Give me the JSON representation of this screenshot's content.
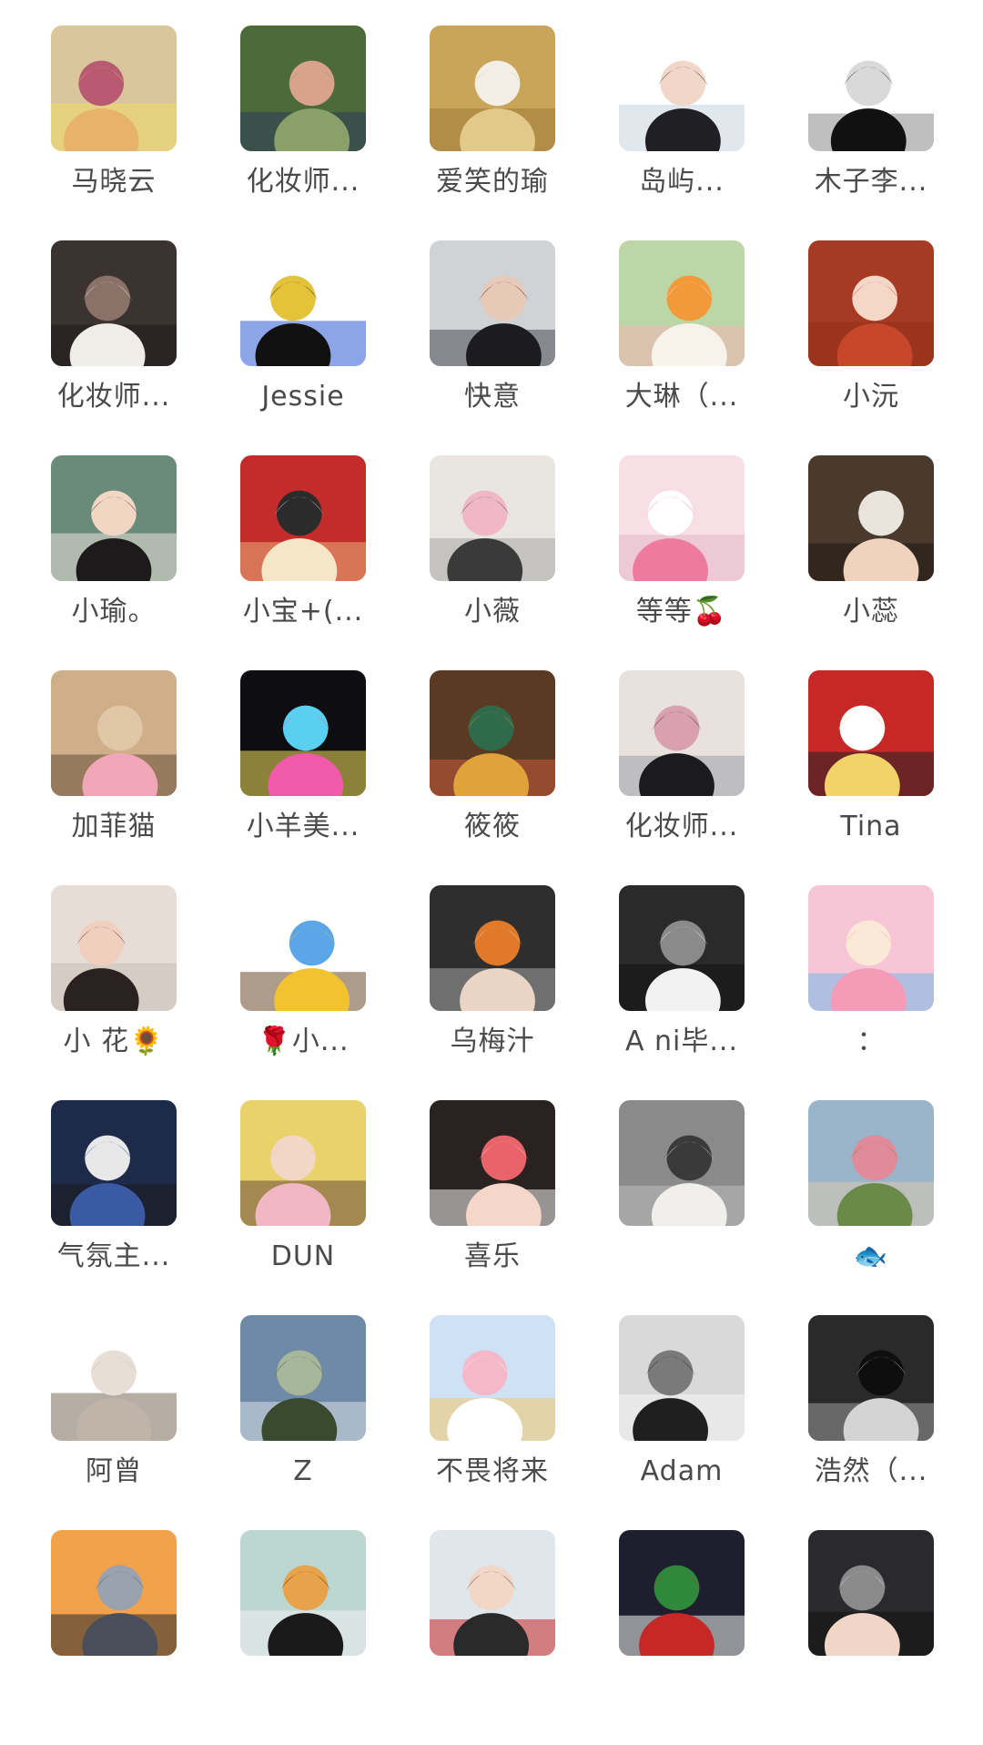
{
  "members": [
    {
      "name": "马晓云",
      "icon": "balloon-field-avatar",
      "colors": [
        "#d9c79b",
        "#e7b36b",
        "#b85a72",
        "#f1d86a"
      ]
    },
    {
      "name": "化妆师...",
      "icon": "woman-outdoor-photo-avatar",
      "colors": [
        "#4d6a3a",
        "#8aa06a",
        "#d8a38a",
        "#2e3a5a"
      ]
    },
    {
      "name": "爱笑的瑜",
      "icon": "woman-wheatfield-avatar",
      "colors": [
        "#c9a55a",
        "#e2c98a",
        "#f3efe6",
        "#9c7a3a"
      ]
    },
    {
      "name": "岛屿...",
      "icon": "anime-girl-glasses-avatar",
      "colors": [
        "#ffffff",
        "#1f1f24",
        "#f1d7c7",
        "#c6d4df"
      ]
    },
    {
      "name": "木子李...",
      "icon": "ink-sketch-girl-avatar",
      "colors": [
        "#ffffff",
        "#111111",
        "#d9d9d9",
        "#8a8a8a"
      ]
    },
    {
      "name": "化妆师...",
      "icon": "woman-turtleneck-avatar",
      "colors": [
        "#3a3330",
        "#f0ede8",
        "#8a7268",
        "#1d1a19"
      ]
    },
    {
      "name": "Jessie",
      "icon": "child-drawing-avatar",
      "colors": [
        "#ffffff",
        "#111111",
        "#e4c33a",
        "#2e5bd7"
      ]
    },
    {
      "name": "快意",
      "icon": "woman-portrait-avatar",
      "colors": [
        "#cfd3d6",
        "#1c1c20",
        "#e8c9b8",
        "#4a4e58"
      ]
    },
    {
      "name": "大琳（...",
      "icon": "bunny-carrot-avatar",
      "colors": [
        "#bcd6a6",
        "#f7f3ea",
        "#f29a3a",
        "#f2b6b6"
      ]
    },
    {
      "name": "小沅",
      "icon": "red-square-avatar",
      "colors": [
        "#a63a22",
        "#c7472b",
        "#f5d7c8",
        "#8f2f1a"
      ]
    },
    {
      "name": "小瑜。",
      "icon": "anime-curly-hair-avatar",
      "colors": [
        "#6a8a7a",
        "#1d1a1c",
        "#f2d6c4",
        "#e9e2d8"
      ]
    },
    {
      "name": "小宝+(...",
      "icon": "sticker-grid-avatar",
      "colors": [
        "#c42b2b",
        "#f5e6c8",
        "#2b2b2b",
        "#e8b37a"
      ]
    },
    {
      "name": "小薇",
      "icon": "girl-bicycle-avatar",
      "colors": [
        "#e9e6e1",
        "#3a3a3a",
        "#f0b7c9",
        "#a6a6a6"
      ]
    },
    {
      "name": "等等🍒",
      "icon": "pink-cartoon-avatar",
      "colors": [
        "#f8dfe6",
        "#ef7aa0",
        "#ffffff",
        "#e4b7c7"
      ]
    },
    {
      "name": "小蕊",
      "icon": "little-girl-eating-avatar",
      "colors": [
        "#4a3a2e",
        "#f1d2bd",
        "#e9e4dc",
        "#1f1714"
      ]
    },
    {
      "name": "加菲猫",
      "icon": "patrick-star-avatar",
      "colors": [
        "#cfae8a",
        "#f2a7b8",
        "#e0c7a6",
        "#6a5038"
      ]
    },
    {
      "name": "小羊美...",
      "icon": "makeup-logo-avatar",
      "colors": [
        "#0e0e12",
        "#f05aa8",
        "#5ad0f0",
        "#f3e05a"
      ]
    },
    {
      "name": "筱筱",
      "icon": "vintage-art-avatar",
      "colors": [
        "#5a3a22",
        "#e0a23a",
        "#2f6a4a",
        "#c65a3a"
      ]
    },
    {
      "name": "化妆师...",
      "icon": "photographer-avatar",
      "colors": [
        "#e8e1dc",
        "#1a1a1f",
        "#d9a1b0",
        "#9aa0a8"
      ]
    },
    {
      "name": "Tina",
      "icon": "cans-avatar",
      "colors": [
        "#c62828",
        "#f2d36a",
        "#ffffff",
        "#222222"
      ]
    },
    {
      "name": "小 花🌻",
      "icon": "girl-lying-avatar",
      "colors": [
        "#e5ddd6",
        "#2a2220",
        "#f1cfbf",
        "#c9bfb8"
      ]
    },
    {
      "name": "🌹小...",
      "icon": "laughing-emoji-avatar",
      "colors": [
        "#ffffff",
        "#f2c32e",
        "#5aa6e8",
        "#6a4a2a"
      ]
    },
    {
      "name": "乌梅汁",
      "icon": "couple-costume-avatar",
      "colors": [
        "#2e2e2e",
        "#e9d4c6",
        "#e07a2a",
        "#a6a6a6"
      ]
    },
    {
      "name": "A ni毕...",
      "icon": "bw-man-hat-avatar",
      "colors": [
        "#2a2a2a",
        "#f2f2f2",
        "#8a8a8a",
        "#111111"
      ]
    },
    {
      "name": "：",
      "icon": "pink-hair-girl-avatar",
      "colors": [
        "#f6c6d6",
        "#f59ab7",
        "#fbe9d8",
        "#7ab8e8"
      ]
    },
    {
      "name": "气氛主...",
      "icon": "event-stage-avatar",
      "colors": [
        "#1e2a4a",
        "#3a5aa6",
        "#e8e8e8",
        "#1a1a1a"
      ]
    },
    {
      "name": "DUN",
      "icon": "woman-pink-dress-avatar",
      "colors": [
        "#e9d26a",
        "#f2b7c4",
        "#f1d7c5",
        "#6a4a3a"
      ]
    },
    {
      "name": "喜乐",
      "icon": "cartoon-girl-glasses-avatar",
      "colors": [
        "#2a2220",
        "#f5d6c8",
        "#e8636a",
        "#f2f2f2"
      ]
    },
    {
      "name": "",
      "icon": "white-dog-avatar",
      "colors": [
        "#8a8a8a",
        "#f0efec",
        "#3a3a3a",
        "#bdbdbd"
      ]
    },
    {
      "name": "🐟",
      "icon": "garden-path-avatar",
      "colors": [
        "#9ab4c9",
        "#6a8a4a",
        "#e08a9a",
        "#d9c9b0"
      ]
    },
    {
      "name": "阿曾",
      "icon": "chibi-meditation-avatar",
      "colors": [
        "#ffffff",
        "#bfb4a8",
        "#e7dfd5",
        "#7a6a5a"
      ]
    },
    {
      "name": "Z",
      "icon": "landscape-lake-avatar",
      "colors": [
        "#6f8aa6",
        "#3a4a2e",
        "#a7b89a",
        "#d8e0e6"
      ]
    },
    {
      "name": "不畏将来",
      "icon": "duck-plush-avatar",
      "colors": [
        "#cfe1f4",
        "#ffffff",
        "#f5b8c8",
        "#f2c86a"
      ]
    },
    {
      "name": "Adam",
      "icon": "street-photo-avatar",
      "colors": [
        "#d9d9d9",
        "#1f1f1f",
        "#7a7a7a",
        "#f4f4f4"
      ]
    },
    {
      "name": "浩然（...",
      "icon": "bw-face-closeup-avatar",
      "colors": [
        "#2a2a2a",
        "#d4d4d4",
        "#0e0e0e",
        "#9a9a9a"
      ]
    },
    {
      "name": "",
      "icon": "sunset-mountain-avatar",
      "colors": [
        "#f2a24a",
        "#4a4e5a",
        "#9aa2b0",
        "#2a2a30"
      ]
    },
    {
      "name": "",
      "icon": "black-panther-avatar",
      "colors": [
        "#bcd6d0",
        "#1a1a1a",
        "#e8a24a",
        "#f0f0f0"
      ]
    },
    {
      "name": "",
      "icon": "two-men-photo-avatar",
      "colors": [
        "#dfe6ec",
        "#2a2a2a",
        "#f2d6c6",
        "#c62828"
      ]
    },
    {
      "name": "",
      "icon": "santa-christmas-avatar",
      "colors": [
        "#1e1e2e",
        "#c62828",
        "#2e8a3a",
        "#f2f2f2"
      ]
    },
    {
      "name": "",
      "icon": "woman-headphones-avatar",
      "colors": [
        "#2a2a2e",
        "#f1d6c8",
        "#8a8a8a",
        "#111111"
      ]
    }
  ]
}
